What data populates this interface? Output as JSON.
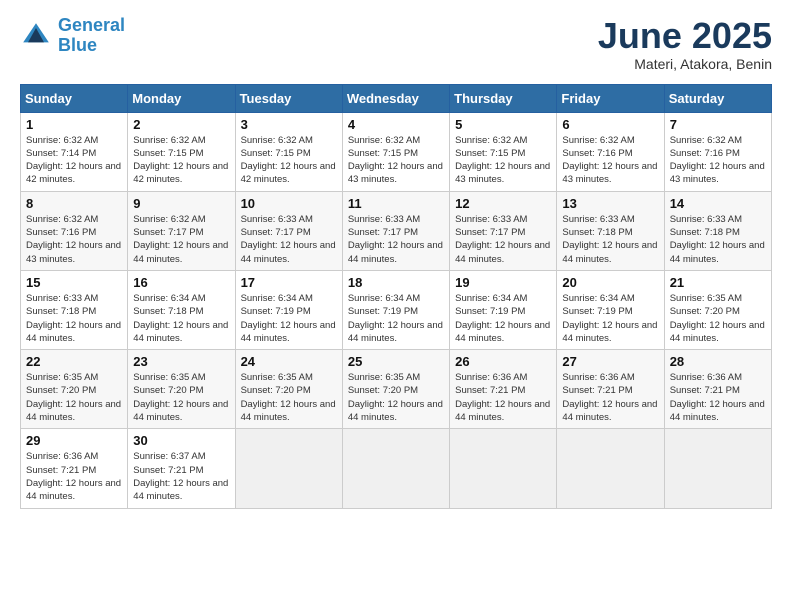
{
  "header": {
    "logo_line1": "General",
    "logo_line2": "Blue",
    "month": "June 2025",
    "location": "Materi, Atakora, Benin"
  },
  "weekdays": [
    "Sunday",
    "Monday",
    "Tuesday",
    "Wednesday",
    "Thursday",
    "Friday",
    "Saturday"
  ],
  "weeks": [
    [
      {
        "day": "1",
        "sunrise": "6:32 AM",
        "sunset": "7:14 PM",
        "daylight": "12 hours and 42 minutes."
      },
      {
        "day": "2",
        "sunrise": "6:32 AM",
        "sunset": "7:15 PM",
        "daylight": "12 hours and 42 minutes."
      },
      {
        "day": "3",
        "sunrise": "6:32 AM",
        "sunset": "7:15 PM",
        "daylight": "12 hours and 42 minutes."
      },
      {
        "day": "4",
        "sunrise": "6:32 AM",
        "sunset": "7:15 PM",
        "daylight": "12 hours and 43 minutes."
      },
      {
        "day": "5",
        "sunrise": "6:32 AM",
        "sunset": "7:15 PM",
        "daylight": "12 hours and 43 minutes."
      },
      {
        "day": "6",
        "sunrise": "6:32 AM",
        "sunset": "7:16 PM",
        "daylight": "12 hours and 43 minutes."
      },
      {
        "day": "7",
        "sunrise": "6:32 AM",
        "sunset": "7:16 PM",
        "daylight": "12 hours and 43 minutes."
      }
    ],
    [
      {
        "day": "8",
        "sunrise": "6:32 AM",
        "sunset": "7:16 PM",
        "daylight": "12 hours and 43 minutes."
      },
      {
        "day": "9",
        "sunrise": "6:32 AM",
        "sunset": "7:17 PM",
        "daylight": "12 hours and 44 minutes."
      },
      {
        "day": "10",
        "sunrise": "6:33 AM",
        "sunset": "7:17 PM",
        "daylight": "12 hours and 44 minutes."
      },
      {
        "day": "11",
        "sunrise": "6:33 AM",
        "sunset": "7:17 PM",
        "daylight": "12 hours and 44 minutes."
      },
      {
        "day": "12",
        "sunrise": "6:33 AM",
        "sunset": "7:17 PM",
        "daylight": "12 hours and 44 minutes."
      },
      {
        "day": "13",
        "sunrise": "6:33 AM",
        "sunset": "7:18 PM",
        "daylight": "12 hours and 44 minutes."
      },
      {
        "day": "14",
        "sunrise": "6:33 AM",
        "sunset": "7:18 PM",
        "daylight": "12 hours and 44 minutes."
      }
    ],
    [
      {
        "day": "15",
        "sunrise": "6:33 AM",
        "sunset": "7:18 PM",
        "daylight": "12 hours and 44 minutes."
      },
      {
        "day": "16",
        "sunrise": "6:34 AM",
        "sunset": "7:18 PM",
        "daylight": "12 hours and 44 minutes."
      },
      {
        "day": "17",
        "sunrise": "6:34 AM",
        "sunset": "7:19 PM",
        "daylight": "12 hours and 44 minutes."
      },
      {
        "day": "18",
        "sunrise": "6:34 AM",
        "sunset": "7:19 PM",
        "daylight": "12 hours and 44 minutes."
      },
      {
        "day": "19",
        "sunrise": "6:34 AM",
        "sunset": "7:19 PM",
        "daylight": "12 hours and 44 minutes."
      },
      {
        "day": "20",
        "sunrise": "6:34 AM",
        "sunset": "7:19 PM",
        "daylight": "12 hours and 44 minutes."
      },
      {
        "day": "21",
        "sunrise": "6:35 AM",
        "sunset": "7:20 PM",
        "daylight": "12 hours and 44 minutes."
      }
    ],
    [
      {
        "day": "22",
        "sunrise": "6:35 AM",
        "sunset": "7:20 PM",
        "daylight": "12 hours and 44 minutes."
      },
      {
        "day": "23",
        "sunrise": "6:35 AM",
        "sunset": "7:20 PM",
        "daylight": "12 hours and 44 minutes."
      },
      {
        "day": "24",
        "sunrise": "6:35 AM",
        "sunset": "7:20 PM",
        "daylight": "12 hours and 44 minutes."
      },
      {
        "day": "25",
        "sunrise": "6:35 AM",
        "sunset": "7:20 PM",
        "daylight": "12 hours and 44 minutes."
      },
      {
        "day": "26",
        "sunrise": "6:36 AM",
        "sunset": "7:21 PM",
        "daylight": "12 hours and 44 minutes."
      },
      {
        "day": "27",
        "sunrise": "6:36 AM",
        "sunset": "7:21 PM",
        "daylight": "12 hours and 44 minutes."
      },
      {
        "day": "28",
        "sunrise": "6:36 AM",
        "sunset": "7:21 PM",
        "daylight": "12 hours and 44 minutes."
      }
    ],
    [
      {
        "day": "29",
        "sunrise": "6:36 AM",
        "sunset": "7:21 PM",
        "daylight": "12 hours and 44 minutes."
      },
      {
        "day": "30",
        "sunrise": "6:37 AM",
        "sunset": "7:21 PM",
        "daylight": "12 hours and 44 minutes."
      },
      null,
      null,
      null,
      null,
      null
    ]
  ]
}
